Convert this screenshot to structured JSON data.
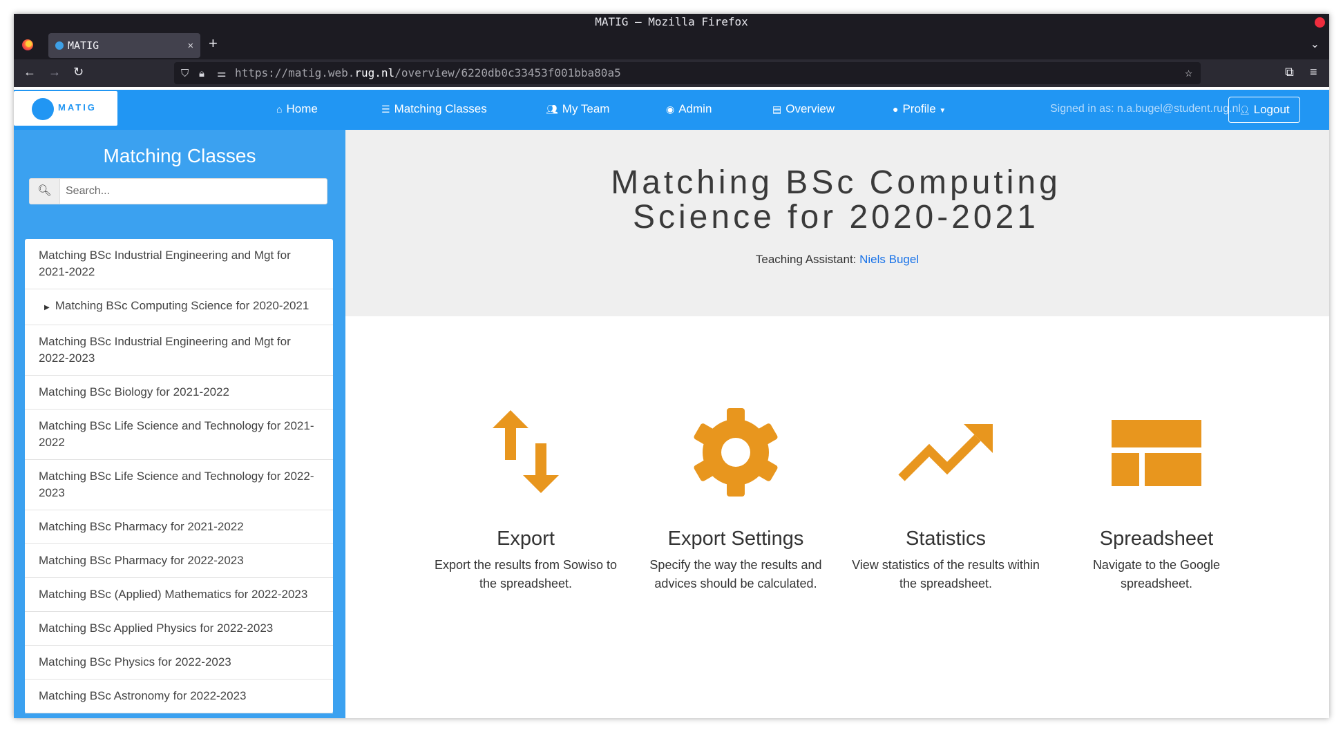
{
  "browser": {
    "window_title": "MATIG — Mozilla Firefox",
    "tab_title": "MATIG",
    "url_scheme": "https://matig.web.",
    "url_host": "rug.nl",
    "url_path": "/overview/6220db0c33453f001bba80a5"
  },
  "header": {
    "logo_text": "MATIG",
    "nav": [
      {
        "label": "Home",
        "icon": "home-icon"
      },
      {
        "label": "Matching Classes",
        "icon": "list-icon"
      },
      {
        "label": "My Team",
        "icon": "people-icon"
      },
      {
        "label": "Admin",
        "icon": "admin-icon"
      },
      {
        "label": "Overview",
        "icon": "overview-icon"
      },
      {
        "label": "Profile",
        "icon": "account-icon"
      }
    ],
    "signed_in": "Signed in as: n.a.bugel@student.rug.nl",
    "logout_label": "Logout"
  },
  "sidebar": {
    "title": "Matching Classes",
    "search_placeholder": "Search...",
    "items": [
      "Matching BSc Industrial Engineering and Mgt for 2021-2022",
      "Matching BSc Computing Science for 2020-2021",
      "Matching BSc Industrial Engineering and Mgt for 2022-2023",
      "Matching BSc Biology for 2021-2022",
      "Matching BSc Life Science and Technology for 2021-2022",
      "Matching BSc Life Science and Technology for 2022-2023",
      "Matching BSc Pharmacy for 2021-2022",
      "Matching BSc Pharmacy for 2022-2023",
      "Matching BSc (Applied) Mathematics for 2022-2023",
      "Matching BSc Applied Physics for 2022-2023",
      "Matching BSc Physics for 2022-2023",
      "Matching BSc Astronomy for 2022-2023"
    ],
    "active_index": 1
  },
  "main": {
    "title": "Matching BSc Computing Science for 2020-2021",
    "ta_label": "Teaching Assistant:",
    "ta_name": "Niels Bugel",
    "accent_color": "#e8961e",
    "cards": [
      {
        "title": "Export",
        "desc": "Export the results from Sowiso to the spreadsheet.",
        "icon": "swap-vert-icon"
      },
      {
        "title": "Export Settings",
        "desc": "Specify the way the results and advices should be calculated.",
        "icon": "settings-gear-icon"
      },
      {
        "title": "Statistics",
        "desc": "View statistics of the results within the spreadsheet.",
        "icon": "trending-up-icon"
      },
      {
        "title": "Spreadsheet",
        "desc": "Navigate to the Google spreadsheet.",
        "icon": "spreadsheet-icon"
      }
    ]
  }
}
